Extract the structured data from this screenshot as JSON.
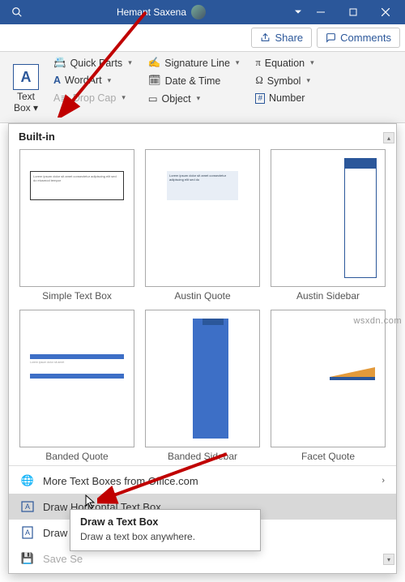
{
  "titlebar": {
    "username": "Hemant Saxena"
  },
  "sharebar": {
    "share_label": "Share",
    "comments_label": "Comments"
  },
  "ribbon": {
    "text_box_line1": "Text",
    "text_box_line2": "Box",
    "quick_parts": "Quick Parts",
    "word_art": "WordArt",
    "drop_cap": "Drop Cap",
    "signature_line": "Signature Line",
    "date_time": "Date & Time",
    "object": "Object",
    "equation": "Equation",
    "symbol": "Symbol",
    "number": "Number"
  },
  "dropdown": {
    "header": "Built-in",
    "items_row1": [
      {
        "label": "Simple Text Box"
      },
      {
        "label": "Austin Quote"
      },
      {
        "label": "Austin Sidebar"
      }
    ],
    "items_row2": [
      {
        "label": "Banded Quote"
      },
      {
        "label": "Banded Sidebar"
      },
      {
        "label": "Facet Quote"
      }
    ],
    "menu": {
      "more_boxes": "More Text Boxes from Office.com",
      "draw_horizontal": "Draw Horizontal Text Box",
      "draw_vertical": "Draw V",
      "save_selection": "Save Se"
    }
  },
  "tooltip": {
    "title": "Draw a Text Box",
    "body": "Draw a text box anywhere."
  },
  "watermark": "wsxdn.com"
}
